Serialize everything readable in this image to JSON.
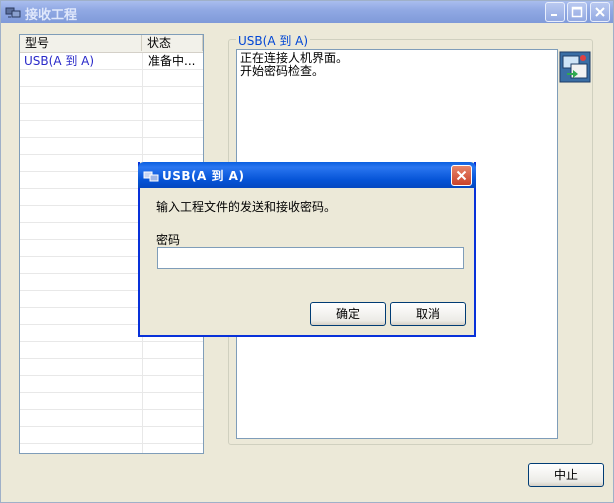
{
  "window": {
    "title": "接收工程",
    "icon": "transfer-app-icon"
  },
  "project_list": {
    "columns": [
      "型号",
      "状态"
    ],
    "rows": [
      {
        "model": "USB(A 到 A)",
        "status": "准备中..."
      }
    ]
  },
  "connection_group": {
    "label": "USB(A 到 A)",
    "log_lines": [
      "正在连接人机界面。",
      "开始密码检查。"
    ],
    "side_icon": "hmi-transfer-icon"
  },
  "stop_button": "中止",
  "dialog": {
    "title": "USB(A 到 A)",
    "icon": "transfer-app-icon",
    "message": "输入工程文件的发送和接收密码。",
    "password_label": "密码",
    "password_value": "",
    "ok_label": "确定",
    "cancel_label": "取消"
  },
  "colors": {
    "dialog_titlebar": "#0553d6",
    "close_button": "#c9422a",
    "list_text": "#2a2ac9",
    "group_label": "#0046d5"
  }
}
